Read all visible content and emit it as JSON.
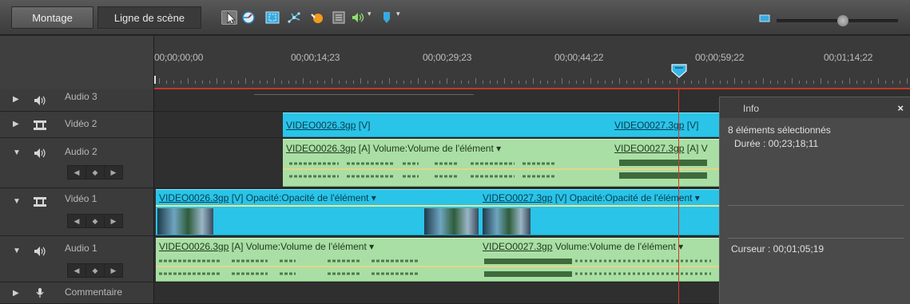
{
  "tabs": {
    "montage": "Montage",
    "timeline": "Ligne de scène"
  },
  "toolbar": {
    "icons": [
      "selection-tool-icon",
      "time-stretch-icon",
      "smart-fix-icon",
      "motion-track-icon",
      "smart-mix-icon",
      "markers-icon",
      "audio-meter-icon",
      "marker-icon"
    ],
    "dropdown_glyph": "▾"
  },
  "zoom": {
    "level": 0.55
  },
  "ruler": {
    "timecodes": [
      "00;00;00;00",
      "00;00;14;23",
      "00;00;29;23",
      "00;00;44;22",
      "00;00;59;22",
      "00;01;14;22"
    ]
  },
  "tracks": [
    {
      "name": "Audio 3",
      "kind": "audio",
      "expanded": false
    },
    {
      "name": "Vidéo 2",
      "kind": "video",
      "expanded": false
    },
    {
      "name": "Audio 2",
      "kind": "audio",
      "expanded": true
    },
    {
      "name": "Vidéo 1",
      "kind": "video",
      "expanded": true
    },
    {
      "name": "Audio 1",
      "kind": "audio",
      "expanded": true
    },
    {
      "name": "Commentaire",
      "kind": "narration",
      "expanded": false
    }
  ],
  "keyframe_nav": {
    "prev": "◀",
    "add": "◆",
    "next": "▶"
  },
  "clips": {
    "v2_a": {
      "name": "VIDEO0026.3gp",
      "suffix": " [V]"
    },
    "v2_b": {
      "name": "VIDEO0027.3gp",
      "suffix": " [V]"
    },
    "a2_a": {
      "name": "VIDEO0026.3gp",
      "suffix": " [A]  Volume:Volume de l'élément ▾"
    },
    "a2_b": {
      "name": "VIDEO0027.3gp",
      "suffix": " [A]  V"
    },
    "v1_a": {
      "name": "VIDEO0026.3gp",
      "suffix": " [V]   Opacité:Opacité de l'élément ▾"
    },
    "v1_b": {
      "name": "VIDEO0027.3gp",
      "suffix": " [V] Opacité:Opacité de l'élément ▾"
    },
    "a1_a": {
      "name": "VIDEO0026.3gp",
      "suffix": " [A]  Volume:Volume de l'élément ▾"
    },
    "a1_b": {
      "name": "VIDEO0027.3gp",
      "suffix": " Volume:Volume de l'élément ▾"
    }
  },
  "info": {
    "title": "Info",
    "close": "×",
    "selected": "8 éléments sélectionnés",
    "duration": "Durée : 00;23;18;11",
    "cursor": "Curseur : 00;01;05;19"
  }
}
